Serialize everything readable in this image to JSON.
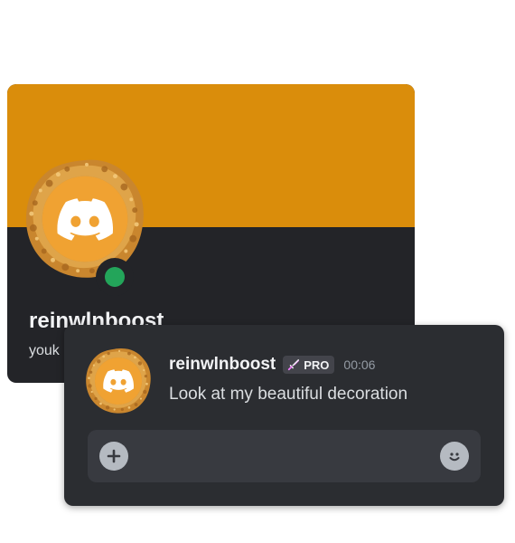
{
  "profile": {
    "display_name": "reinwlnboost",
    "handle": "youk",
    "banner_color": "#DA8D0B",
    "avatar_icon": "discord-logo-icon",
    "decoration_icon": "golden-pastry-decoration-icon",
    "status": "online",
    "status_color": "#23A55A"
  },
  "message": {
    "username": "reinwlnboost",
    "badge_label": "PRO",
    "badge_icon": "sword-icon",
    "timestamp": "00:06",
    "text": "Look at my beautiful decoration",
    "avatar_icon": "discord-logo-icon"
  },
  "composer": {
    "add_icon": "plus-icon",
    "emoji_icon": "smiley-icon"
  },
  "colors": {
    "card_background": "#232428",
    "message_background": "#2B2D31",
    "input_background": "#383A40",
    "avatar_orange": "#F0A232"
  }
}
